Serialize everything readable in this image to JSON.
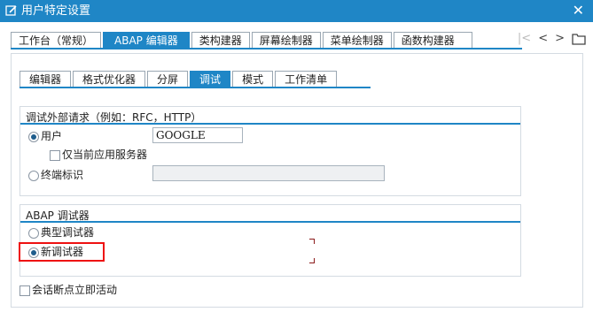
{
  "window": {
    "title": "用户特定设置",
    "close_label": "✕"
  },
  "main_tabs": [
    "工作台（常规）",
    "ABAP 编辑器",
    "类构建器",
    "屏幕绘制器",
    "菜单绘制器",
    "函数构建器"
  ],
  "nav": {
    "first": "|<",
    "prev": "<",
    "next": ">",
    "menu_icon": "tab-list-icon"
  },
  "sub_tabs": [
    "编辑器",
    "格式优化器",
    "分屏",
    "调试",
    "模式",
    "工作清单"
  ],
  "external_debug": {
    "title": "调试外部请求（例如：RFC，HTTP）",
    "user_label": "用户",
    "user_value": "GOOGLE",
    "app_server_only_label": "仅当前应用服务器",
    "terminal_label": "终端标识",
    "terminal_value": ""
  },
  "abap_debugger": {
    "title": "ABAP 调试器",
    "classic_label": "典型调试器",
    "new_label": "新调试器",
    "selected": "new"
  },
  "session_breakpoint_label": "会话断点立即活动",
  "colors": {
    "accent": "#1f86c6",
    "highlight": "#e11111"
  }
}
